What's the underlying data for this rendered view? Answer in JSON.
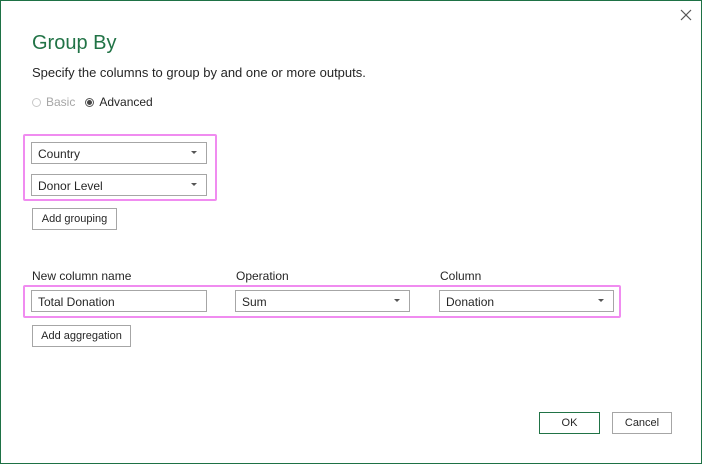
{
  "dialog": {
    "title": "Group By",
    "subtitle": "Specify the columns to group by and one or more outputs."
  },
  "mode": {
    "options": [
      {
        "label": "Basic",
        "checked": false,
        "disabled": true
      },
      {
        "label": "Advanced",
        "checked": true,
        "disabled": false
      }
    ]
  },
  "grouping": {
    "fields": [
      "Country",
      "Donor Level"
    ],
    "add_label": "Add grouping"
  },
  "aggregation": {
    "headers": {
      "name": "New column name",
      "operation": "Operation",
      "column": "Column"
    },
    "row": {
      "name": "Total Donation",
      "operation": "Sum",
      "column": "Donation"
    },
    "add_label": "Add aggregation"
  },
  "footer": {
    "ok_label": "OK",
    "cancel_label": "Cancel"
  },
  "colors": {
    "accent": "#217346",
    "highlight": "#f08cf0"
  },
  "icons": {
    "close": "close-icon",
    "dropdown": "chevron-down-icon"
  }
}
